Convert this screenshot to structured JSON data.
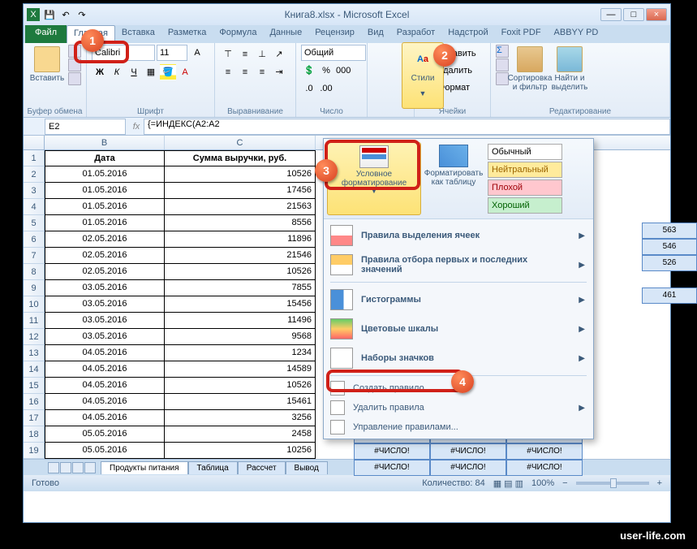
{
  "window": {
    "title": "Книга8.xlsx - Microsoft Excel",
    "min": "—",
    "max": "□",
    "close": "×"
  },
  "tabs": {
    "file": "Файл",
    "items": [
      "Главная",
      "Вставка",
      "Разметка",
      "Формула",
      "Данные",
      "Рецензир",
      "Вид",
      "Разработ",
      "Надстрой",
      "Foxit PDF",
      "ABBYY PD"
    ]
  },
  "ribbon": {
    "clipboard": {
      "label": "Буфер обмена",
      "paste": "Вставить"
    },
    "font": {
      "label": "Шрифт",
      "name": "Calibri",
      "size": "11",
      "bold": "Ж",
      "italic": "К",
      "underline": "Ч"
    },
    "align": {
      "label": "Выравнивание"
    },
    "number": {
      "label": "Число",
      "format": "Общий"
    },
    "styles": {
      "label": "Стили"
    },
    "cells": {
      "label": "Ячейки",
      "insert": "Вставить",
      "delete": "Удалить",
      "format": "Формат"
    },
    "edit": {
      "label": "Редактирование",
      "sort": "Сортировка и фильтр",
      "find": "Найти и выделить"
    }
  },
  "namebox": "E2",
  "formula": "{=ИНДЕКС(A2:A2",
  "headers": {
    "B": "B",
    "C": "C"
  },
  "table": {
    "h1": "Дата",
    "h2": "Сумма выручки, руб.",
    "rows": [
      {
        "r": "1"
      },
      {
        "r": "2",
        "d": "01.05.2016",
        "v": "10526"
      },
      {
        "r": "3",
        "d": "01.05.2016",
        "v": "17456"
      },
      {
        "r": "4",
        "d": "01.05.2016",
        "v": "21563"
      },
      {
        "r": "5",
        "d": "01.05.2016",
        "v": "8556"
      },
      {
        "r": "6",
        "d": "02.05.2016",
        "v": "11896"
      },
      {
        "r": "7",
        "d": "02.05.2016",
        "v": "21546"
      },
      {
        "r": "8",
        "d": "02.05.2016",
        "v": "10526"
      },
      {
        "r": "9",
        "d": "03.05.2016",
        "v": "7855"
      },
      {
        "r": "10",
        "d": "03.05.2016",
        "v": "15456"
      },
      {
        "r": "11",
        "d": "03.05.2016",
        "v": "11496"
      },
      {
        "r": "12",
        "d": "03.05.2016",
        "v": "9568"
      },
      {
        "r": "13",
        "d": "04.05.2016",
        "v": "1234"
      },
      {
        "r": "14",
        "d": "04.05.2016",
        "v": "14589"
      },
      {
        "r": "15",
        "d": "04.05.2016",
        "v": "10526"
      },
      {
        "r": "16",
        "d": "04.05.2016",
        "v": "15461"
      },
      {
        "r": "17",
        "d": "04.05.2016",
        "v": "3256"
      },
      {
        "r": "18",
        "d": "05.05.2016",
        "v": "2458"
      },
      {
        "r": "19",
        "d": "05.05.2016",
        "v": "10256"
      }
    ]
  },
  "right_vals": [
    "563",
    "546",
    "526",
    "",
    "461"
  ],
  "err": "#ЧИСЛО!",
  "sheets": [
    "Продукты питания",
    "Таблица",
    "Рассчет",
    "Вывод"
  ],
  "status": {
    "ready": "Готово",
    "count": "Количество: 84",
    "zoom": "100%"
  },
  "styles_menu": {
    "cf": "Условное форматирование",
    "ft": "Форматировать как таблицу",
    "normal": "Обычный",
    "neutral": "Нейтральный",
    "bad": "Плохой",
    "good": "Хороший",
    "items": [
      "Правила выделения ячеек",
      "Правила отбора первых и последних значений",
      "Гистограммы",
      "Цветовые шкалы",
      "Наборы значков"
    ],
    "create": "Создать правило...",
    "delete": "Удалить правила",
    "manage": "Управление правилами..."
  },
  "callouts": {
    "c1": "1",
    "c2": "2",
    "c3": "3",
    "c4": "4"
  },
  "watermark": "user-life.com"
}
